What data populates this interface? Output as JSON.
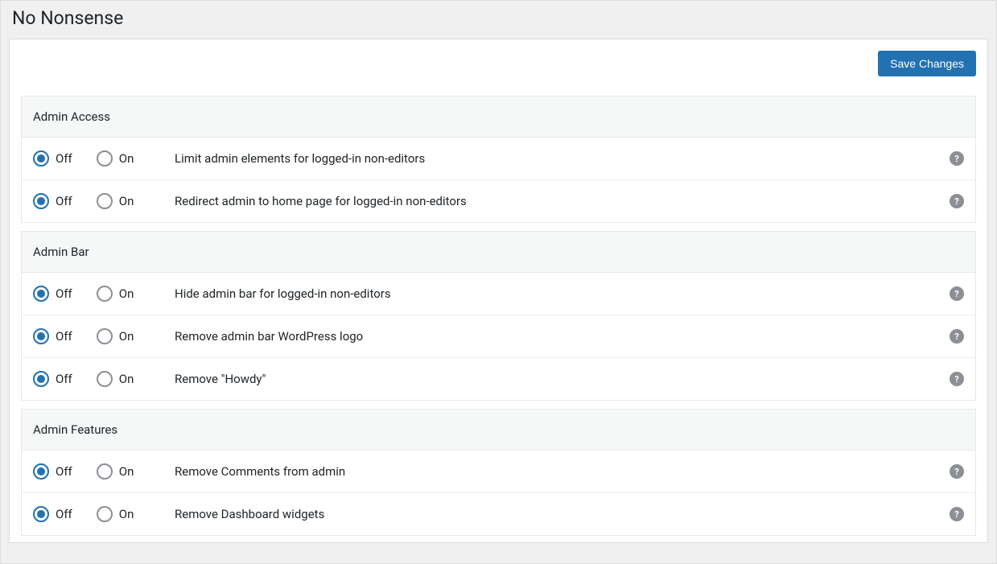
{
  "page": {
    "title": "No Nonsense"
  },
  "actions": {
    "save_label": "Save Changes"
  },
  "labels": {
    "off": "Off",
    "on": "On",
    "help_glyph": "?"
  },
  "sections": [
    {
      "id": "admin-access",
      "title": "Admin Access",
      "settings": [
        {
          "id": "limit-admin-elements",
          "label": "Limit admin elements for logged-in non-editors",
          "value": "off"
        },
        {
          "id": "redirect-admin-home",
          "label": "Redirect admin to home page for logged-in non-editors",
          "value": "off"
        }
      ]
    },
    {
      "id": "admin-bar",
      "title": "Admin Bar",
      "settings": [
        {
          "id": "hide-admin-bar",
          "label": "Hide admin bar for logged-in non-editors",
          "value": "off"
        },
        {
          "id": "remove-wp-logo",
          "label": "Remove admin bar WordPress logo",
          "value": "off"
        },
        {
          "id": "remove-howdy",
          "label": "Remove \"Howdy\"",
          "value": "off"
        }
      ]
    },
    {
      "id": "admin-features",
      "title": "Admin Features",
      "settings": [
        {
          "id": "remove-comments",
          "label": "Remove Comments from admin",
          "value": "off"
        },
        {
          "id": "remove-dashboard-widgets",
          "label": "Remove Dashboard widgets",
          "value": "off"
        }
      ]
    }
  ]
}
